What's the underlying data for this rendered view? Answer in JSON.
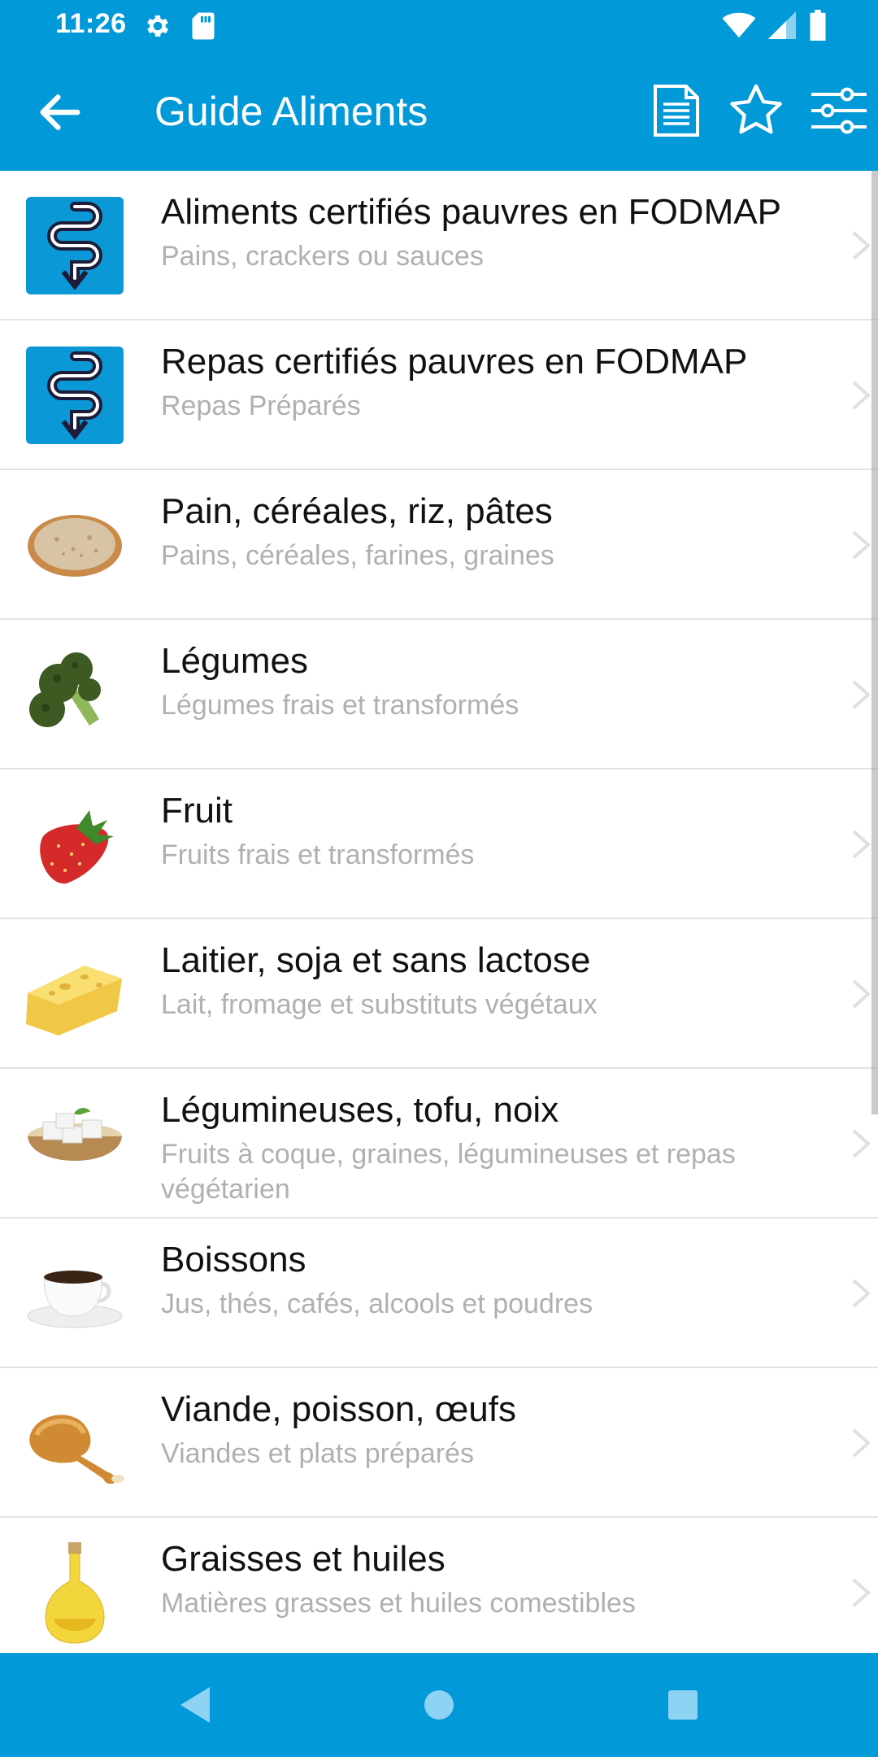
{
  "status_bar": {
    "time": "11:26",
    "icons": [
      "gear-icon",
      "sd-card-icon",
      "wifi-icon",
      "signal-icon",
      "battery-icon"
    ]
  },
  "app_bar": {
    "title": "Guide Aliments",
    "actions": [
      "document-icon",
      "star-icon",
      "filter-sliders-icon"
    ]
  },
  "colors": {
    "primary": "#0299d8",
    "title_text": "#111111",
    "subtitle_text": "#b0b0b0",
    "divider": "#e3e3e3"
  },
  "categories": [
    {
      "title": "Aliments certifiés pauvres en FODMAP",
      "subtitle": "Pains, crackers ou sauces",
      "icon": "fodmap-logo-icon"
    },
    {
      "title": "Repas certifiés pauvres en FODMAP",
      "subtitle": "Repas Préparés",
      "icon": "fodmap-logo-icon"
    },
    {
      "title": "Pain, céréales, riz, pâtes",
      "subtitle": "Pains, céréales, farines, graines",
      "icon": "bread-icon"
    },
    {
      "title": "Légumes",
      "subtitle": "Légumes frais et transformés",
      "icon": "broccoli-icon"
    },
    {
      "title": "Fruit",
      "subtitle": "Fruits frais et transformés",
      "icon": "strawberry-icon"
    },
    {
      "title": "Laitier, soja et sans lactose",
      "subtitle": "Lait, fromage et substituts végétaux",
      "icon": "cheese-icon"
    },
    {
      "title": "Légumineuses, tofu, noix",
      "subtitle": "Fruits à coque, graines, légumineuses et repas végétarien",
      "icon": "tofu-bowl-icon"
    },
    {
      "title": "Boissons",
      "subtitle": "Jus, thés, cafés, alcools et poudres",
      "icon": "coffee-cup-icon"
    },
    {
      "title": "Viande, poisson, œufs",
      "subtitle": "Viandes et plats préparés",
      "icon": "chicken-leg-icon"
    },
    {
      "title": "Graisses et huiles",
      "subtitle": "Matières grasses et huiles comestibles",
      "icon": "oil-bottle-icon"
    }
  ],
  "nav_bar": [
    "nav-back-icon",
    "nav-home-icon",
    "nav-recent-icon"
  ]
}
